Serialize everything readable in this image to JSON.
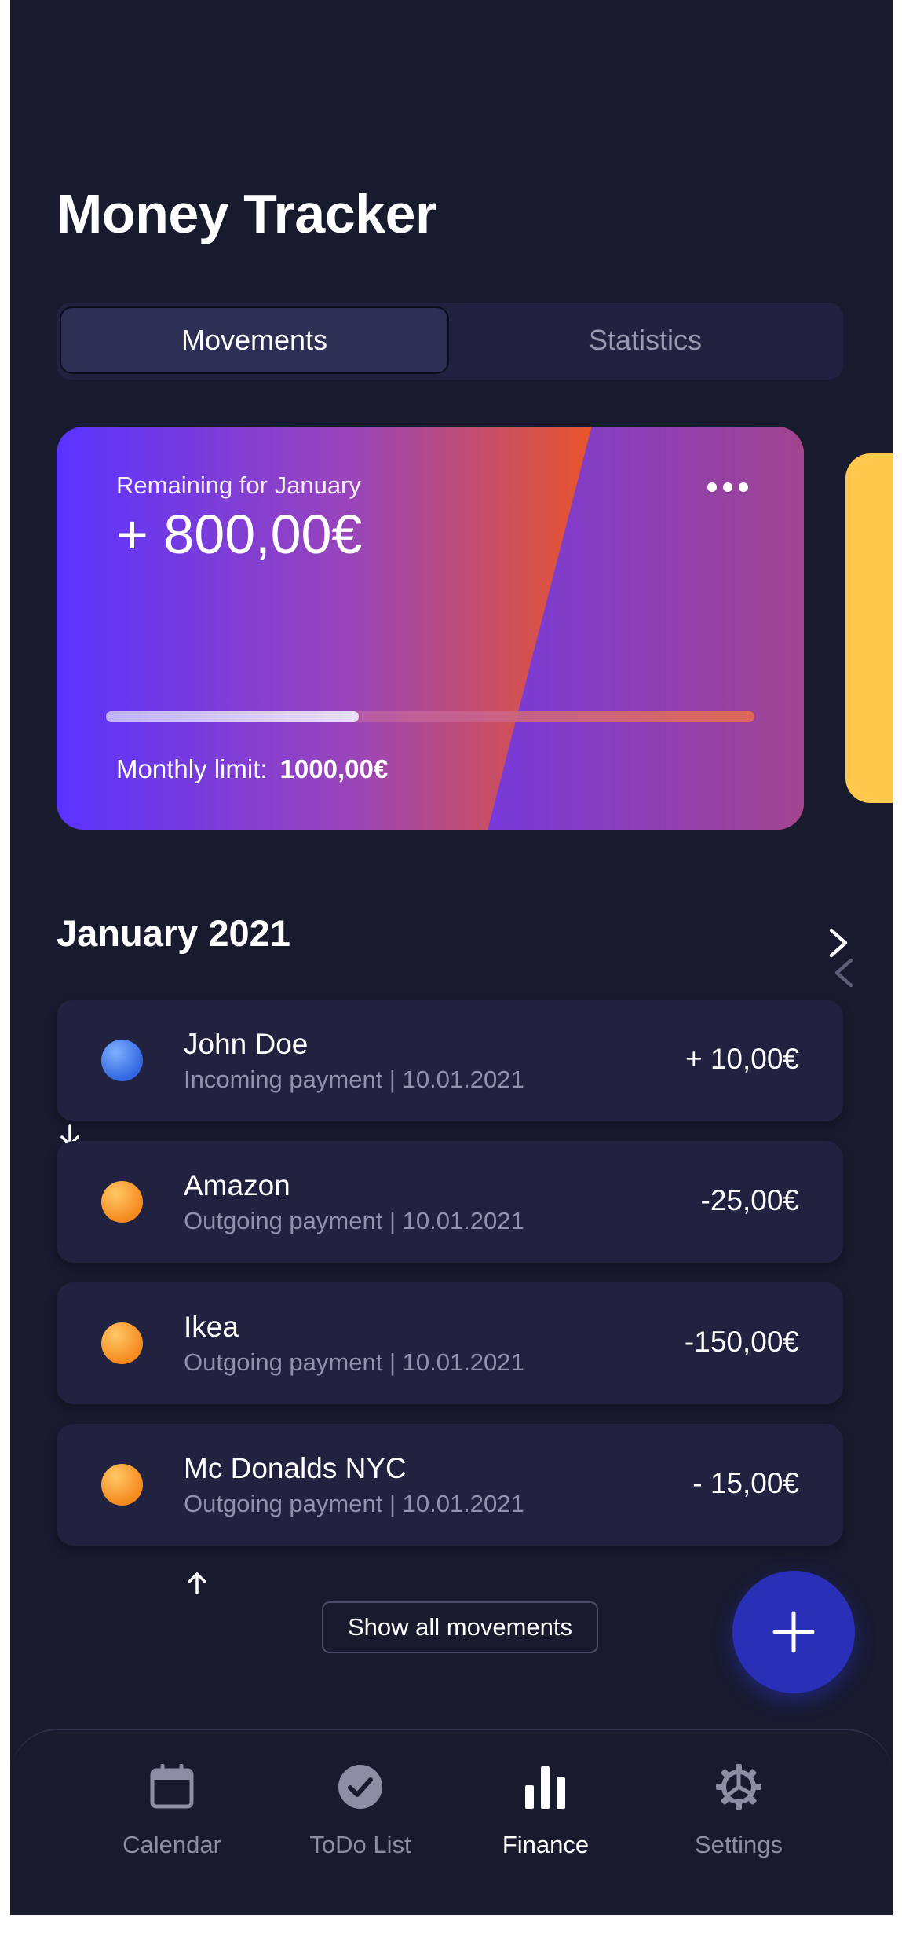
{
  "app": {
    "title": "Money Tracker"
  },
  "tabs": [
    {
      "label": "Movements",
      "active": true
    },
    {
      "label": "Statistics",
      "active": false
    }
  ],
  "card": {
    "label": "Remaining for January",
    "amount": "+ 800,00€",
    "progress_fraction": 0.39,
    "limit_label": "Monthly limit:",
    "limit_value": "1000,00€",
    "more_icon": "more-horizontal-icon",
    "gradient_colors": [
      "#5a33ff",
      "#e0533a",
      "#ff5a00"
    ],
    "peek_card_color": "#ffc94d"
  },
  "month": {
    "label": "January 2021"
  },
  "transactions": [
    {
      "name": "John Doe",
      "subtitle": "Incoming payment | 10.01.2021",
      "amount": "+ 10,00€",
      "dot_color": "blue",
      "direction": "incoming"
    },
    {
      "name": "Amazon",
      "subtitle": "Outgoing payment | 10.01.2021",
      "amount": "-25,00€",
      "dot_color": "orange",
      "direction": "outgoing"
    },
    {
      "name": "Ikea",
      "subtitle": "Outgoing payment | 10.01.2021",
      "amount": "-150,00€",
      "dot_color": "orange",
      "direction": "outgoing"
    },
    {
      "name": "Mc Donalds NYC",
      "subtitle": "Outgoing payment | 10.01.2021",
      "amount": "- 15,00€",
      "dot_color": "orange",
      "direction": "outgoing"
    }
  ],
  "actions": {
    "show_all_label": "Show all movements",
    "fab_icon": "plus-icon"
  },
  "nav": [
    {
      "label": "Calendar",
      "icon": "calendar-icon",
      "active": false
    },
    {
      "label": "ToDo List",
      "icon": "check-circle-icon",
      "active": false
    },
    {
      "label": "Finance",
      "icon": "bar-chart-icon",
      "active": true
    },
    {
      "label": "Settings",
      "icon": "gear-icon",
      "active": false
    }
  ],
  "colors": {
    "background": "#181a2e",
    "surface": "#202240",
    "accent": "#2a2fb8"
  }
}
